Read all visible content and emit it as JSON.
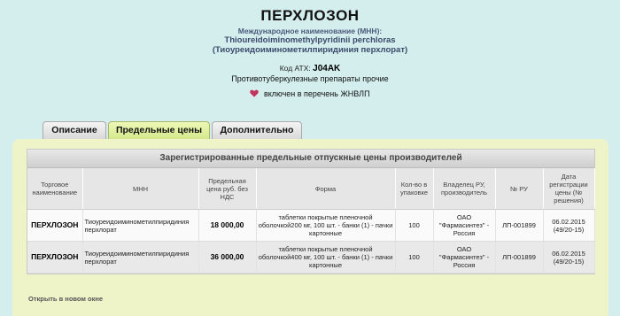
{
  "header": {
    "title": "ПЕРХЛОЗОН",
    "mnn_caption": "Международное наименование (МНН):",
    "mnn_latin": "Thioureidoiminomethylpyridinii perchloras",
    "mnn_ru": "(Тиоуреидоиминометилпиридиния перхлорат)",
    "atc_label": "Код АТХ:",
    "atc_code": "J04AK",
    "atc_desc": "Противотуберкулезные препараты прочие",
    "zhnvlp_text": "включен в перечень ЖНВЛП"
  },
  "tabs": [
    {
      "label": "Описание"
    },
    {
      "label": "Предельные цены"
    },
    {
      "label": "Дополнительно"
    }
  ],
  "table": {
    "caption": "Зарегистрированные предельные отпускные цены производителей",
    "headers": [
      "Торговое наименование",
      "МНН",
      "Предельная цена руб. без НДС",
      "Форма",
      "Кол-во в упаковке",
      "Владелец РУ, производитель",
      "№ РУ",
      "Дата регистрации цены (№ решения)"
    ],
    "rows": [
      {
        "name": "ПЕРХЛОЗОН",
        "mnn": "Тиоуреидоиминометилпиридиния перхлорат",
        "price": "18 000,00",
        "form": "таблетки покрытые пленочной оболочкой200 мг, 100 шт. - банки (1) - пачки картонные",
        "qty": "100",
        "owner": "ОАО \"Фармасинтез\" - Россия",
        "ru": "ЛП-001899",
        "date": "06.02.2015 (49/20-15)"
      },
      {
        "name": "ПЕРХЛОЗОН",
        "mnn": "Тиоуреидоиминометилпиридиния перхлорат",
        "price": "36 000,00",
        "form": "таблетки покрытые пленочной оболочкой400 мг, 100 шт. - банки (1) - пачки картонные",
        "qty": "100",
        "owner": "ОАО \"Фармасинтез\" - Россия",
        "ru": "ЛП-001899",
        "date": "06.02.2015 (49/20-15)"
      }
    ]
  },
  "open_new_window": "Открыть в новом окне",
  "icons": {
    "zhnvlp": "heart-icon"
  },
  "colors": {
    "background": "#d4eeee",
    "panel": "#eef4c8",
    "active_tab": "#d3e78a",
    "heart": "#c0335a"
  }
}
